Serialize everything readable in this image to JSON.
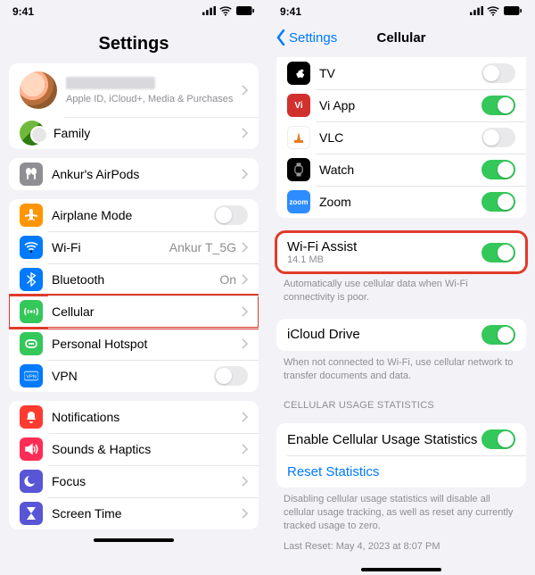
{
  "status": {
    "time": "9:41"
  },
  "left": {
    "title": "Settings",
    "profile_sub": "Apple ID, iCloud+, Media & Purchases",
    "family": "Family",
    "airpods": "Ankur's AirPods",
    "airplane": "Airplane Mode",
    "wifi": {
      "label": "Wi-Fi",
      "value": "Ankur T_5G"
    },
    "bt": {
      "label": "Bluetooth",
      "value": "On"
    },
    "cellular": "Cellular",
    "hotspot": "Personal Hotspot",
    "vpn": "VPN",
    "notifications": "Notifications",
    "sounds": "Sounds & Haptics",
    "focus": "Focus",
    "screentime": "Screen Time"
  },
  "right": {
    "back": "Settings",
    "title": "Cellular",
    "apps": {
      "tv": "TV",
      "vi": "Vi App",
      "vlc": "VLC",
      "watch": "Watch",
      "zoom": "Zoom"
    },
    "wifi_assist": {
      "label": "Wi-Fi Assist",
      "sub": "14.1 MB"
    },
    "wifi_assist_foot": "Automatically use cellular data when Wi-Fi connectivity is poor.",
    "icloud": "iCloud Drive",
    "icloud_foot": "When not connected to Wi-Fi, use cellular network to transfer documents and data.",
    "stats_header": "CELLULAR USAGE STATISTICS",
    "stats_enable": "Enable Cellular Usage Statistics",
    "stats_reset": "Reset Statistics",
    "stats_foot1": "Disabling cellular usage statistics will disable all cellular usage tracking, as well as reset any currently tracked usage to zero.",
    "stats_foot2": "Last Reset: May 4, 2023 at 8:07 PM"
  }
}
